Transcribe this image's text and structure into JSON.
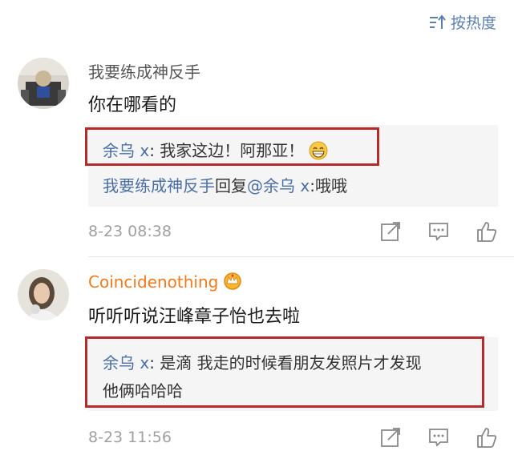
{
  "sort": {
    "label": "按热度",
    "icon": "sort-icon"
  },
  "comments": [
    {
      "username": "我要练成神反手",
      "content": "你在哪看的",
      "replies": [
        {
          "author": "余乌 x",
          "sep": ":",
          "text": " 我家这边！阿那亚！",
          "emoji": "grinning-emoji"
        },
        {
          "author": "我要练成神反手",
          "mid": "回复",
          "mention": "@余乌 x",
          "sep": ":",
          "text": "哦哦"
        }
      ],
      "timestamp": "8-23 08:38"
    },
    {
      "username": "Coincidenothing",
      "badge": "crown-badge-icon",
      "content": "听听听说汪峰章子怡也去啦",
      "replies": [
        {
          "author": "余乌 x",
          "sep": ":",
          "text": " 是滴 我走的时候看朋友发照片才发现",
          "text2": "他俩哈哈哈"
        }
      ],
      "timestamp": "8-23 11:56"
    }
  ],
  "colors": {
    "link": "#4a6fa5",
    "vip": "#f07a1d",
    "highlight": "#b52a2a"
  }
}
